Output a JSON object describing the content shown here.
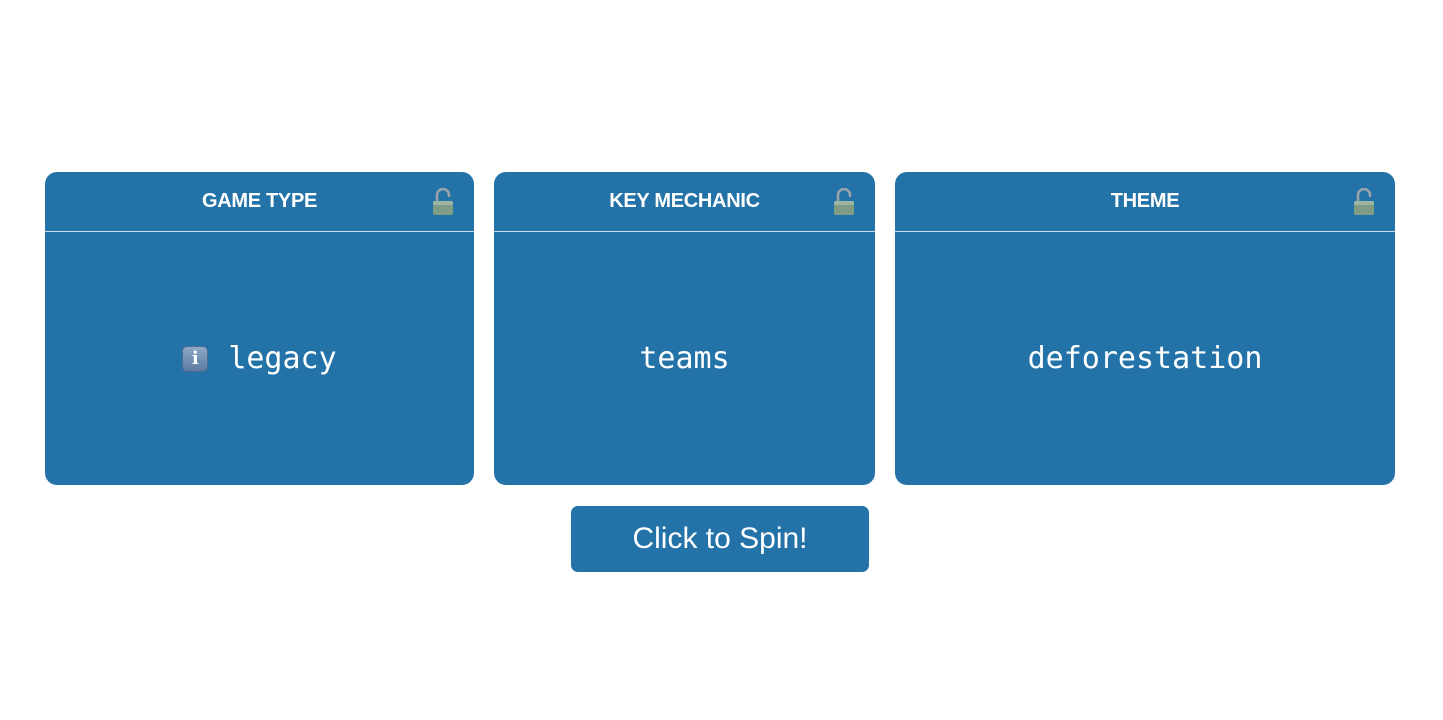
{
  "cards": [
    {
      "title": "GAME TYPE",
      "value": "legacy",
      "lock_icon": "unlocked-padlock-icon",
      "value_icon": "information-icon",
      "value_icon_glyph": "i"
    },
    {
      "title": "KEY MECHANIC",
      "value": "teams",
      "lock_icon": "unlocked-padlock-icon"
    },
    {
      "title": "THEME",
      "value": "deforestation",
      "lock_icon": "unlocked-padlock-icon"
    }
  ],
  "spin_button": {
    "label": "Click to Spin!"
  },
  "colors": {
    "card_background": "#2473a8",
    "button_background": "#2473a8",
    "text": "#ffffff",
    "page_background": "#ffffff"
  }
}
